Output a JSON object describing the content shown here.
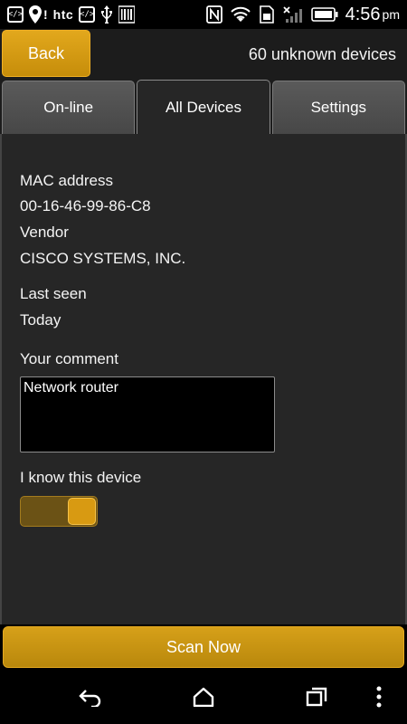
{
  "status_bar": {
    "carrier_logo": "htc",
    "time": "4:56",
    "ampm": "pm",
    "icons": [
      "code-icon",
      "location-icon",
      "code-icon",
      "usb-icon",
      "barcode-icon",
      "nfc-icon",
      "wifi-icon",
      "sim-icon",
      "signal-icon",
      "battery-icon"
    ]
  },
  "header": {
    "back_label": "Back",
    "device_count": "60 unknown devices"
  },
  "tabs": [
    {
      "label": "On-line",
      "active": false
    },
    {
      "label": "All Devices",
      "active": true
    },
    {
      "label": "Settings",
      "active": false
    }
  ],
  "device": {
    "mac_label": "MAC address",
    "mac_value": "00-16-46-99-86-C8",
    "vendor_label": "Vendor",
    "vendor_value": "CISCO SYSTEMS, INC.",
    "last_seen_label": "Last seen",
    "last_seen_value": "Today",
    "comment_label": "Your comment",
    "comment_value": "Network router",
    "know_label": "I know this device",
    "know_value": true
  },
  "scan_label": "Scan Now",
  "colors": {
    "accent": "#d29a15",
    "background": "#262626"
  }
}
